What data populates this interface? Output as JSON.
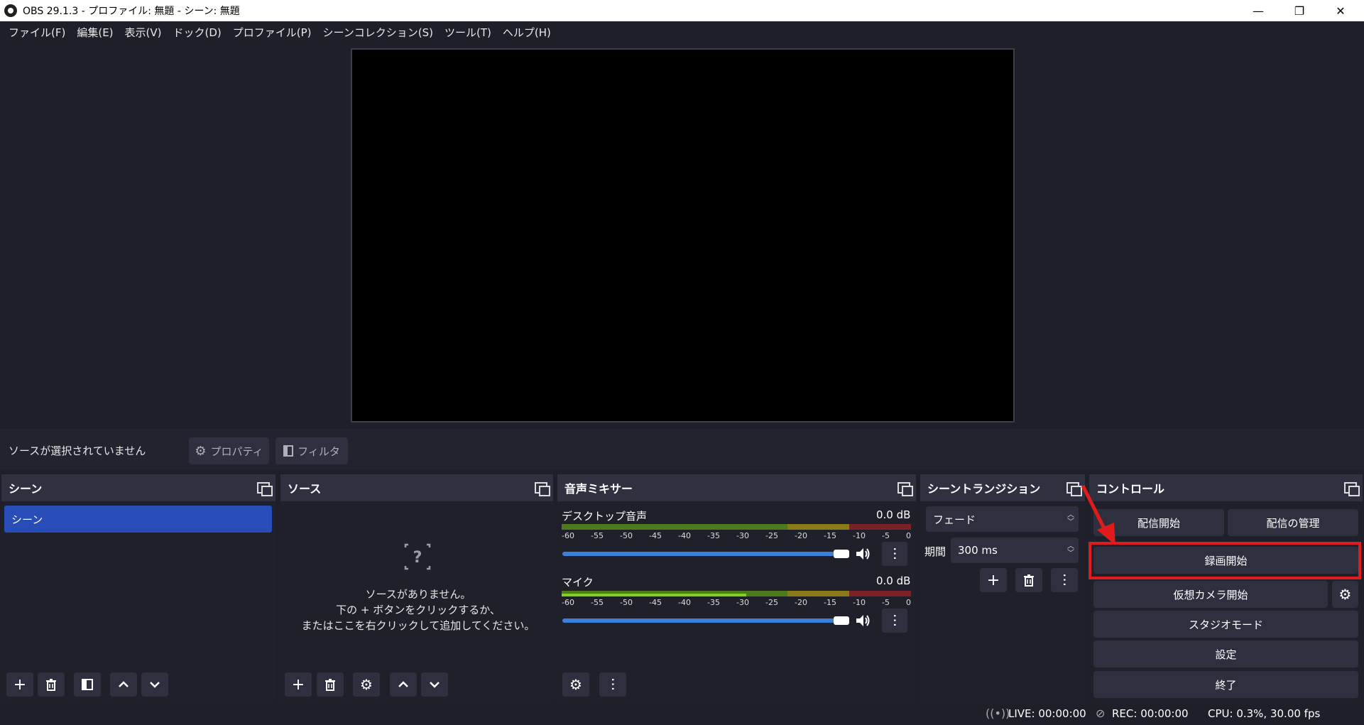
{
  "window": {
    "title": "OBS 29.1.3 - プロファイル: 無題 - シーン: 無題",
    "minimize": "—",
    "restore": "❐",
    "close": "✕"
  },
  "menu": [
    "ファイル(F)",
    "編集(E)",
    "表示(V)",
    "ドック(D)",
    "プロファイル(P)",
    "シーンコレクション(S)",
    "ツール(T)",
    "ヘルプ(H)"
  ],
  "context_bar": {
    "status": "ソースが選択されていません",
    "properties": "プロパティ",
    "filters": "フィルタ"
  },
  "scenes": {
    "title": "シーン",
    "items": [
      "シーン"
    ]
  },
  "sources": {
    "title": "ソース",
    "empty_line1": "ソースがありません。",
    "empty_line2": "下の + ボタンをクリックするか、",
    "empty_line3": "またはここを右クリックして追加してください。"
  },
  "mixer": {
    "title": "音声ミキサー",
    "scale": [
      "-60",
      "-55",
      "-50",
      "-45",
      "-40",
      "-35",
      "-30",
      "-25",
      "-20",
      "-15",
      "-10",
      "-5",
      "0"
    ],
    "channels": [
      {
        "name": "デスクトップ音声",
        "db": "0.0 dB",
        "level": 0.0,
        "volume": 1.0
      },
      {
        "name": "マイク",
        "db": "0.0 dB",
        "level": 0.5,
        "volume": 1.0
      }
    ]
  },
  "transitions": {
    "title": "シーントランジション",
    "type": "フェード",
    "duration_label": "期間",
    "duration_value": "300 ms"
  },
  "controls": {
    "title": "コントロール",
    "start_streaming": "配信開始",
    "manage_broadcast": "配信の管理",
    "start_recording": "録画開始",
    "start_virtualcam": "仮想カメラ開始",
    "studio_mode": "スタジオモード",
    "settings": "設定",
    "exit": "終了"
  },
  "status": {
    "live": "LIVE: 00:00:00",
    "rec": "REC: 00:00:00",
    "cpu": "CPU: 0.3%, 30.00 fps"
  },
  "colors": {
    "accent": "#284cb8",
    "highlight": "#e01b1b",
    "slider": "#3a7fd8"
  }
}
